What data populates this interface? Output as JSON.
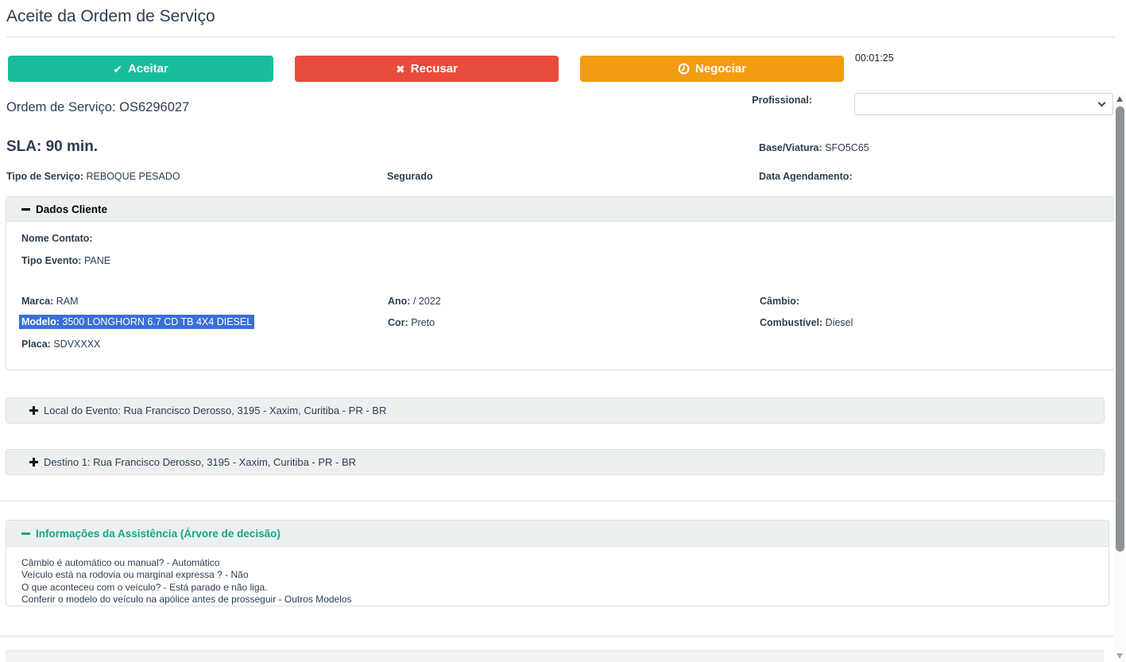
{
  "header": {
    "title": "Aceite da Ordem de Serviço"
  },
  "toolbar": {
    "accept_label": "Aceitar",
    "refuse_label": "Recusar",
    "negotiate_label": "Negociar",
    "accept_icon_glyph": "✔",
    "refuse_icon_glyph": "✖",
    "timer": "00:01:25"
  },
  "summary": {
    "order_label": "Ordem de Serviço:",
    "order_value": "OS6296027",
    "professional_label": "Profissional:",
    "professional_value": "",
    "sla_label": "SLA:",
    "sla_value": "90 min.",
    "base_label": "Base/Viatura:",
    "base_value": "SFO5C65",
    "service_type_label": "Tipo de Serviço:",
    "service_type_value": "REBOQUE PESADO",
    "insured_label": "Segurado",
    "schedule_label": "Data Agendamento:",
    "schedule_value": ""
  },
  "client_panel": {
    "title": "Dados Cliente",
    "contact_label": "Nome Contato:",
    "contact_value": "",
    "event_type_label": "Tipo Evento:",
    "event_type_value": "PANE",
    "brand_label": "Marca:",
    "brand_value": "RAM",
    "year_label": "Ano:",
    "year_value": "/ 2022",
    "gear_label": "Câmbio:",
    "gear_value": "",
    "model_label": "Modelo:",
    "model_value": "3500 LONGHORN 6.7 CD TB 4X4 DIESEL",
    "color_label": "Cor:",
    "color_value": "Preto",
    "fuel_label": "Combustível:",
    "fuel_value": "Diesel",
    "plate_label": "Placa:",
    "plate_value": "SDVXXXX"
  },
  "event_location_panel": {
    "title": "Local do Evento: Rua Francisco Derosso, 3195 - Xaxim, Curitiba - PR - BR"
  },
  "destination_panel": {
    "title": "Destino 1: Rua Francisco Derosso, 3195 - Xaxim, Curitiba - PR - BR"
  },
  "assistance_panel": {
    "title": "Informações da Assistência (Árvore de decisão)",
    "lines": [
      "Câmbio é automático ou manual? - Automático",
      "Veículo está na rodovia ou marginal expressa ? - Não",
      "O que aconteceu com o veículo? - Está parado e não liga.",
      "Conferir o modelo do veículo na apólice antes de prosseguir - Outros Modelos"
    ]
  },
  "colors": {
    "accept_green": "#18bc9c",
    "refuse_red": "#e74c3c",
    "negotiate_orange": "#f39c12",
    "text_dark": "#2c3e50",
    "panel_heading_bg": "#ecf0f1",
    "assistance_title_teal": "#18a689",
    "selection_blue": "#3a6fd8"
  }
}
